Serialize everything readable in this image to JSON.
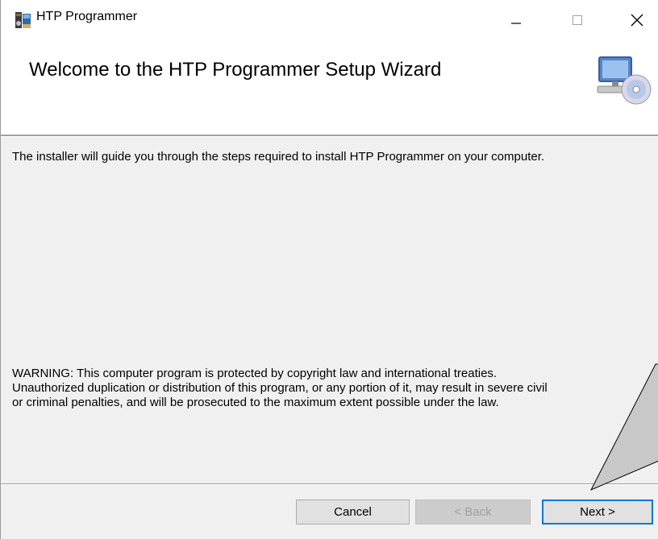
{
  "window": {
    "title": "HTP Programmer"
  },
  "titlebar_buttons": {
    "minimize_icon": "minimize-icon",
    "maximize_icon": "maximize-icon",
    "close_icon": "close-icon"
  },
  "header": {
    "title": "Welcome to the HTP Programmer Setup Wizard",
    "icon": "computer-cd-icon"
  },
  "body": {
    "intro": "The installer will guide you through the steps required to install HTP Programmer on your computer.",
    "warning_lines": [
      "WARNING: This computer program is protected by copyright law and international treaties.",
      "Unauthorized duplication or distribution of this program, or any portion of it, may result in severe civil",
      "or criminal penalties, and will be prosecuted to the maximum extent possible under the law."
    ]
  },
  "buttons": {
    "cancel": "Cancel",
    "back": "< Back",
    "next": "Next >"
  },
  "colors": {
    "accent": "#0078d7",
    "window_bg": "#f0f0f0",
    "header_bg": "#ffffff",
    "callout_fill": "#c8c8c8"
  }
}
